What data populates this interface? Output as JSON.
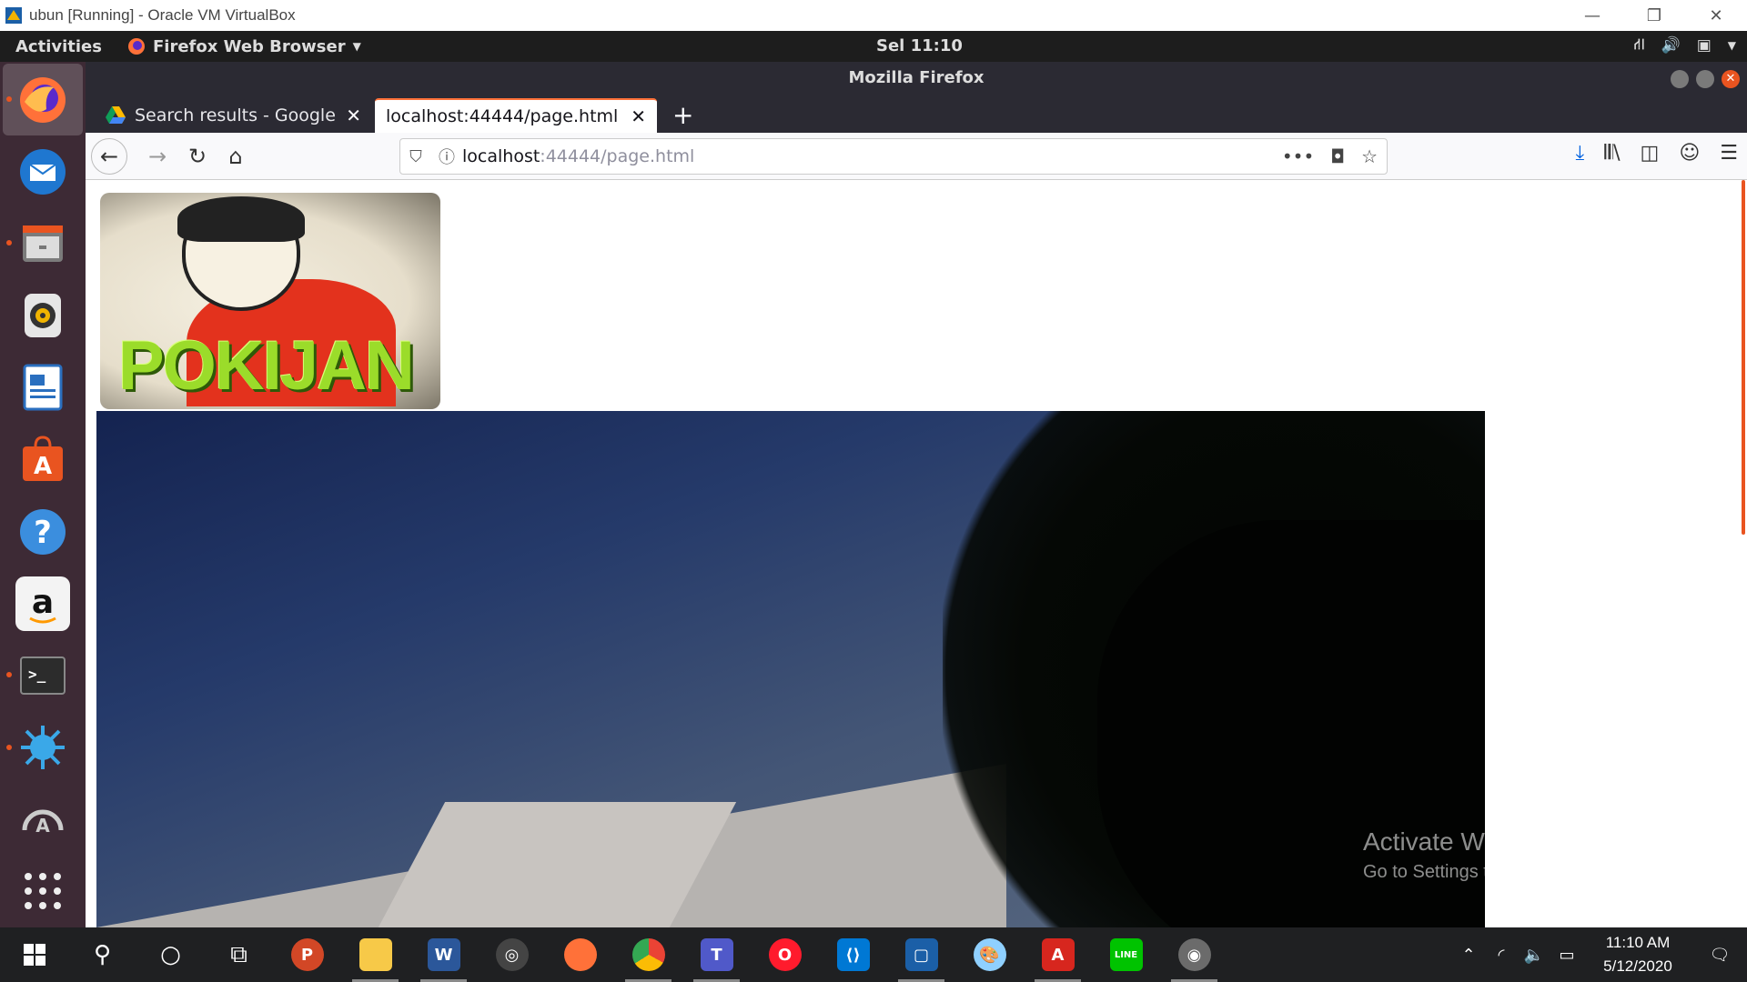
{
  "host_window": {
    "title": "ubun [Running] - Oracle VM VirtualBox",
    "controls": [
      "—",
      "❐",
      "✕"
    ]
  },
  "ubuntu_panel": {
    "activities": "Activities",
    "app_menu": "Firefox Web Browser",
    "clock": "Sel 11:10"
  },
  "firefox": {
    "window_title": "Mozilla Firefox",
    "tabs": [
      {
        "label": "Search results - Google D",
        "active": false
      },
      {
        "label": "localhost:44444/page.html",
        "active": true
      }
    ],
    "url": {
      "host": "localhost",
      "path": ":44444/page.html"
    },
    "toolbar_icons": [
      "download-icon",
      "library-icon",
      "sidebar-icon",
      "account-icon",
      "menu-icon"
    ]
  },
  "page": {
    "banner_text": "POKIJAN"
  },
  "watermark": {
    "line1": "Activate Windows",
    "line2": "Go to Settings to activate Windows."
  },
  "dock": [
    "firefox",
    "thunderbird",
    "files",
    "rhythmbox",
    "writer",
    "software",
    "help",
    "amazon",
    "terminal",
    "splash",
    "updater",
    "apps"
  ],
  "taskbar": {
    "time": "11:10 AM",
    "date": "5/12/2020"
  },
  "colors": {
    "accent": "#e95420",
    "dock_bg": "#3d2a35",
    "firefox_dark": "#2b2a33"
  }
}
